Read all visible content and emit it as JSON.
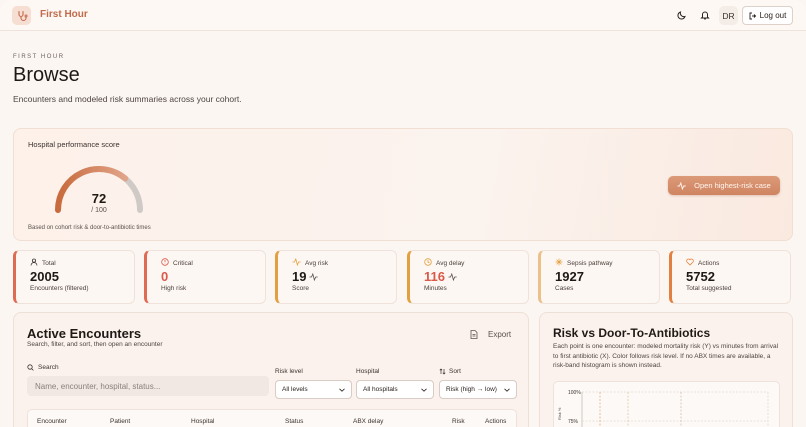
{
  "app": {
    "title": "First Hour",
    "avatar_initials": "DR",
    "logout_label": "Log out",
    "brand_color": "#c26a4a"
  },
  "header": {
    "eyebrow": "FIRST HOUR",
    "title": "Browse",
    "subtitle": "Encounters and modeled risk summaries across your cohort."
  },
  "hero": {
    "label": "Hospital performance score",
    "score": "72",
    "max": "/ 100",
    "score_fraction": 0.72,
    "note": "Based on cohort risk & door-to-antibiotic times",
    "cta_label": "Open highest-risk case"
  },
  "stats": [
    {
      "label": "Total",
      "value": "2005",
      "sub": "Encounters (filtered)",
      "icon": "user-icon",
      "accent": "#e06b55"
    },
    {
      "label": "Critical",
      "value": "0",
      "sub": "High risk",
      "icon": "alert-circle-icon",
      "accent": "#e06b55"
    },
    {
      "label": "Avg risk",
      "value": "19",
      "sub": "Score",
      "icon": "activity-icon",
      "accent": "#e3a041"
    },
    {
      "label": "Avg delay",
      "value": "116",
      "sub": "Minutes",
      "icon": "clock-icon",
      "accent": "#e3a041"
    },
    {
      "label": "Sepsis pathway",
      "value": "1927",
      "sub": "Cases",
      "icon": "sparkle-icon",
      "accent": "#ecc08a"
    },
    {
      "label": "Actions",
      "value": "5752",
      "sub": "Total suggested",
      "icon": "heart-icon",
      "accent": "#e38040"
    }
  ],
  "encounters": {
    "title": "Active Encounters",
    "subtitle": "Search, filter, and sort, then open an encounter",
    "export_label": "Export",
    "search_label": "Search",
    "search_placeholder": "Name, encounter, hospital, status...",
    "filters": {
      "risk_label": "Risk level",
      "risk_value": "All levels",
      "hospital_label": "Hospital",
      "hospital_value": "All hospitals",
      "sort_label": "Sort",
      "sort_value": "Risk (high → low)"
    },
    "columns": [
      "Encounter",
      "Patient",
      "Hospital",
      "Status",
      "ABX delay",
      "Risk",
      "Actions"
    ]
  },
  "scatter": {
    "title": "Risk vs Door-To-Antibiotics",
    "description": "Each point is one encounter: modeled mortality risk (Y) vs minutes from arrival to first antibiotic (X). Color follows risk level. If no ABX times are available, a risk-band histogram is shown instead.",
    "y_ticks": [
      "100%",
      "75%"
    ],
    "y_label": "Risk %"
  }
}
